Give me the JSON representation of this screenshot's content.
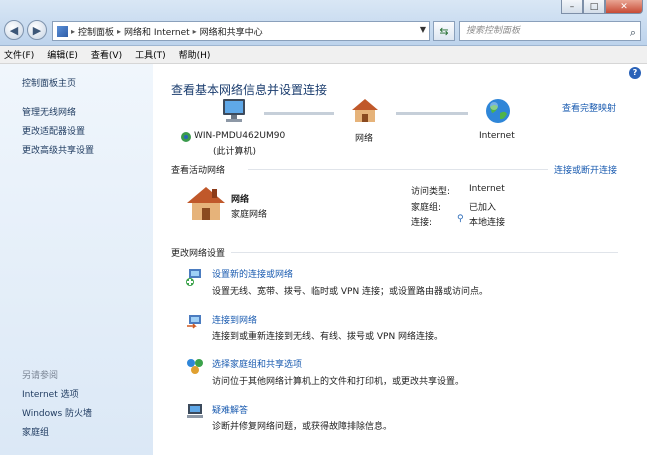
{
  "window": {
    "minimize": "–",
    "maximize": "□",
    "close": "✕"
  },
  "address": {
    "crumbs": [
      "控制面板",
      "网络和 Internet",
      "网络和共享中心"
    ],
    "sep": "▸"
  },
  "search": {
    "placeholder": "搜索控制面板"
  },
  "menu": [
    "文件(F)",
    "编辑(E)",
    "查看(V)",
    "工具(T)",
    "帮助(H)"
  ],
  "sidebar": {
    "home": "控制面板主页",
    "links": [
      "管理无线网络",
      "更改适配器设置",
      "更改高级共享设置"
    ],
    "see_also_title": "另请参阅",
    "see_also": [
      "Internet 选项",
      "Windows 防火墙",
      "家庭组"
    ]
  },
  "main": {
    "title": "查看基本网络信息并设置连接",
    "full_map": "查看完整映射",
    "map": {
      "computer": "WIN-PMDU462UM90",
      "computer_sub": "(此计算机)",
      "network": "网络",
      "internet": "Internet"
    },
    "active": {
      "heading": "查看活动网络",
      "connect_link": "连接或断开连接",
      "net_name": "网络",
      "net_type": "家庭网络",
      "access_type_label": "访问类型:",
      "access_type_value": "Internet",
      "homegroup_label": "家庭组:",
      "homegroup_value": "已加入",
      "connection_label": "连接:",
      "connection_value": "本地连接"
    },
    "change_heading": "更改网络设置",
    "tasks": [
      {
        "title": "设置新的连接或网络",
        "desc": "设置无线、宽带、拨号、临时或 VPN 连接；或设置路由器或访问点。"
      },
      {
        "title": "连接到网络",
        "desc": "连接到或重新连接到无线、有线、拨号或 VPN 网络连接。"
      },
      {
        "title": "选择家庭组和共享选项",
        "desc": "访问位于其他网络计算机上的文件和打印机，或更改共享设置。"
      },
      {
        "title": "疑难解答",
        "desc": "诊断并修复网络问题，或获得故障排除信息。"
      }
    ]
  },
  "colors": {
    "link": "#1a5bb0",
    "title": "#1a3c6e",
    "sidebar_top": "#f0f6fc",
    "sidebar_bottom": "#dbe8f6"
  }
}
